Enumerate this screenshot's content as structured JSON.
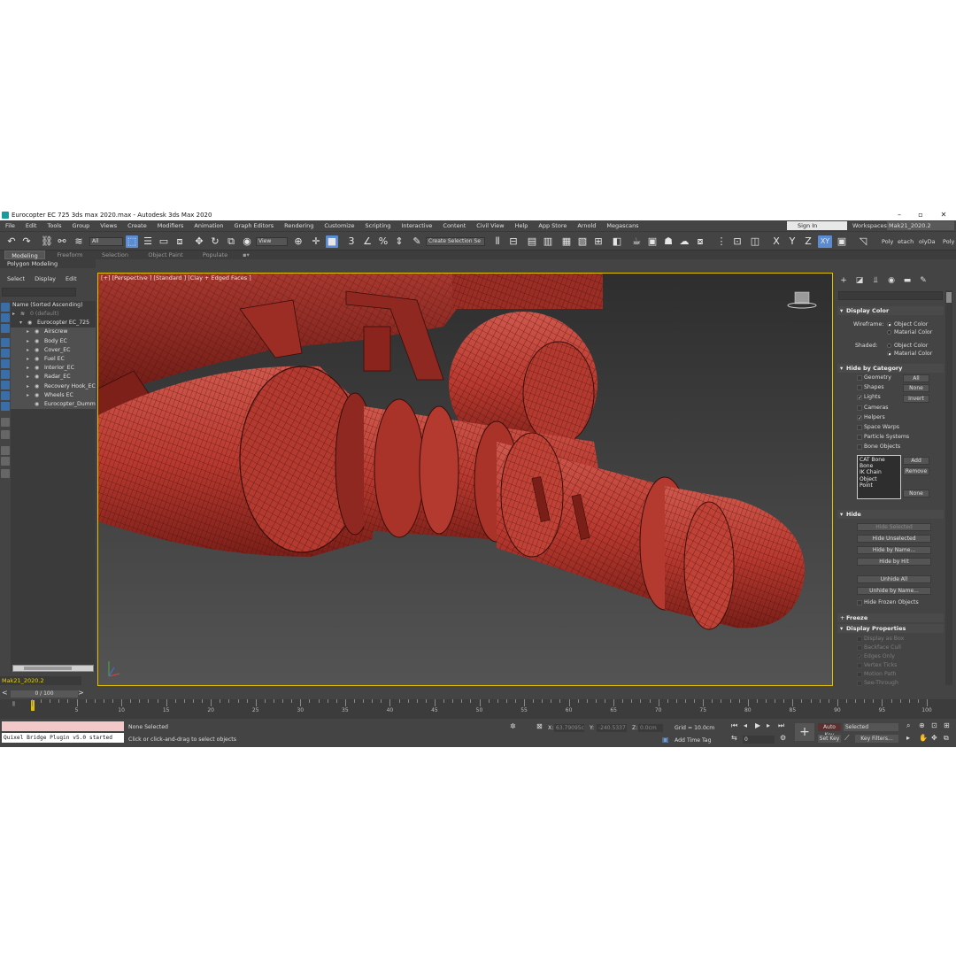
{
  "window": {
    "title": "Eurocopter EC 725 3ds max 2020.max - Autodesk 3ds Max 2020"
  },
  "menu": [
    "File",
    "Edit",
    "Tools",
    "Group",
    "Views",
    "Create",
    "Modifiers",
    "Animation",
    "Graph Editors",
    "Rendering",
    "Customize",
    "Scripting",
    "Interactive",
    "Content",
    "Civil View",
    "Help",
    "App Store",
    "Arnold",
    "Megascans"
  ],
  "account": {
    "sign_in": "Sign In",
    "workspaces_label": "Workspaces:",
    "workspace_value": "Mak21_2020.2"
  },
  "toolbar": {
    "filter_value": "All",
    "refcoord_value": "View",
    "selection_set_placeholder": "Create Selection Se",
    "axis_x": "X",
    "axis_y": "Y",
    "axis_z": "Z",
    "axis_xy": "XY",
    "ext1": "Poly",
    "ext2": "etach",
    "ext3": "olyDa",
    "ext4": "Poly"
  },
  "ribbon": {
    "tabs": [
      "Modeling",
      "Freeform",
      "Selection",
      "Object Paint",
      "Populate"
    ],
    "active_tab": "Modeling",
    "sub": "Polygon Modeling"
  },
  "explorer": {
    "menu": [
      "Select",
      "Display",
      "Edit"
    ],
    "header": "Name (Sorted Ascending)",
    "rows": [
      {
        "label": "0 (default)",
        "indent": 0,
        "dim": true
      },
      {
        "label": "Eurocopter EC_725",
        "indent": 1
      },
      {
        "label": "Airscrew",
        "indent": 2
      },
      {
        "label": "Body EC",
        "indent": 2
      },
      {
        "label": "Cover_EC",
        "indent": 2
      },
      {
        "label": "Fuel EC",
        "indent": 2
      },
      {
        "label": "Interior_EC",
        "indent": 2
      },
      {
        "label": "Radar_EC",
        "indent": 2
      },
      {
        "label": "Recovery Hook_EC",
        "indent": 2
      },
      {
        "label": "Wheels EC",
        "indent": 2
      },
      {
        "label": "Eurocopter_Dumm",
        "indent": 2
      }
    ],
    "layer": "Mak21_2020.2"
  },
  "viewport": {
    "label": "[+] [Perspective ] [Standard ] [Clay + Edged Faces ]"
  },
  "command_panel": {
    "display_color": {
      "title": "Display Color",
      "wireframe_label": "Wireframe:",
      "shaded_label": "Shaded:",
      "object_color": "Object Color",
      "material_color": "Material Color"
    },
    "hide_by_category": {
      "title": "Hide by Category",
      "items": [
        {
          "label": "Geometry",
          "checked": false
        },
        {
          "label": "Shapes",
          "checked": false
        },
        {
          "label": "Lights",
          "checked": true
        },
        {
          "label": "Cameras",
          "checked": false
        },
        {
          "label": "Helpers",
          "checked": true
        },
        {
          "label": "Space Warps",
          "checked": false
        },
        {
          "label": "Particle Systems",
          "checked": false
        },
        {
          "label": "Bone Objects",
          "checked": false
        }
      ],
      "btn_all": "All",
      "btn_none": "None",
      "btn_invert": "Invert",
      "list": [
        "CAT Bone",
        "Bone",
        "IK Chain Object",
        "Point"
      ],
      "btn_add": "Add",
      "btn_remove": "Remove",
      "btn_none2": "None"
    },
    "hide": {
      "title": "Hide",
      "hide_selected": "Hide Selected",
      "hide_unselected": "Hide Unselected",
      "hide_by_name": "Hide by Name...",
      "hide_by_hit": "Hide by Hit",
      "unhide_all": "Unhide All",
      "unhide_by_name": "Unhide by Name...",
      "hide_frozen": "Hide Frozen Objects"
    },
    "freeze": {
      "title": "Freeze"
    },
    "display_properties": {
      "title": "Display Properties",
      "items": [
        {
          "label": "Display as Box",
          "checked": false
        },
        {
          "label": "Backface Cull",
          "checked": false
        },
        {
          "label": "Edges Only",
          "checked": true
        },
        {
          "label": "Vertex Ticks",
          "checked": false
        },
        {
          "label": "Motion Path",
          "checked": false
        },
        {
          "label": "See-Through",
          "checked": false
        }
      ]
    }
  },
  "timeline": {
    "frame": "0 / 100",
    "ticks": [
      0,
      5,
      10,
      15,
      20,
      25,
      30,
      35,
      40,
      45,
      50,
      55,
      60,
      65,
      70,
      75,
      80,
      85,
      90,
      95,
      100
    ],
    "current": 0
  },
  "status": {
    "maxscript": "Quixel Bridge Plugin v5.0 started",
    "selection": "None Selected",
    "prompt": "Click or click-and-drag to select objects",
    "x_label": "X:",
    "x_value": "63.79095c",
    "y_label": "Y:",
    "y_value": "-240.5337",
    "z_label": "Z:",
    "z_value": "0.0cm",
    "grid": "Grid = 10.0cm",
    "add_time_tag": "Add Time Tag",
    "auto_key": "Auto Key",
    "set_key": "Set Key",
    "key_mode": "Selected",
    "key_filters": "Key Filters...",
    "frame_field": "0"
  }
}
